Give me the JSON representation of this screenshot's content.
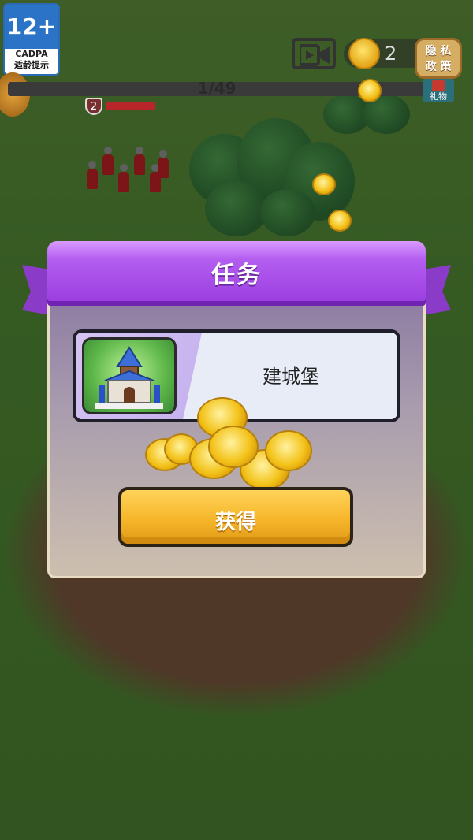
{
  "hud": {
    "age_rating": "12+",
    "age_org": "CADPA",
    "age_note": "适龄提示",
    "coin_count": "2",
    "privacy_line1": "隐 私",
    "privacy_line2": "政 策",
    "progress_text": "1/49",
    "gift_label": "礼物",
    "enemy_level": "2"
  },
  "modal": {
    "title": "任务",
    "task_name": "建城堡",
    "claim_label": "获得"
  },
  "colors": {
    "ribbon": "#9b3fe0",
    "button": "#f6b62a",
    "panel": "#a89cae"
  }
}
